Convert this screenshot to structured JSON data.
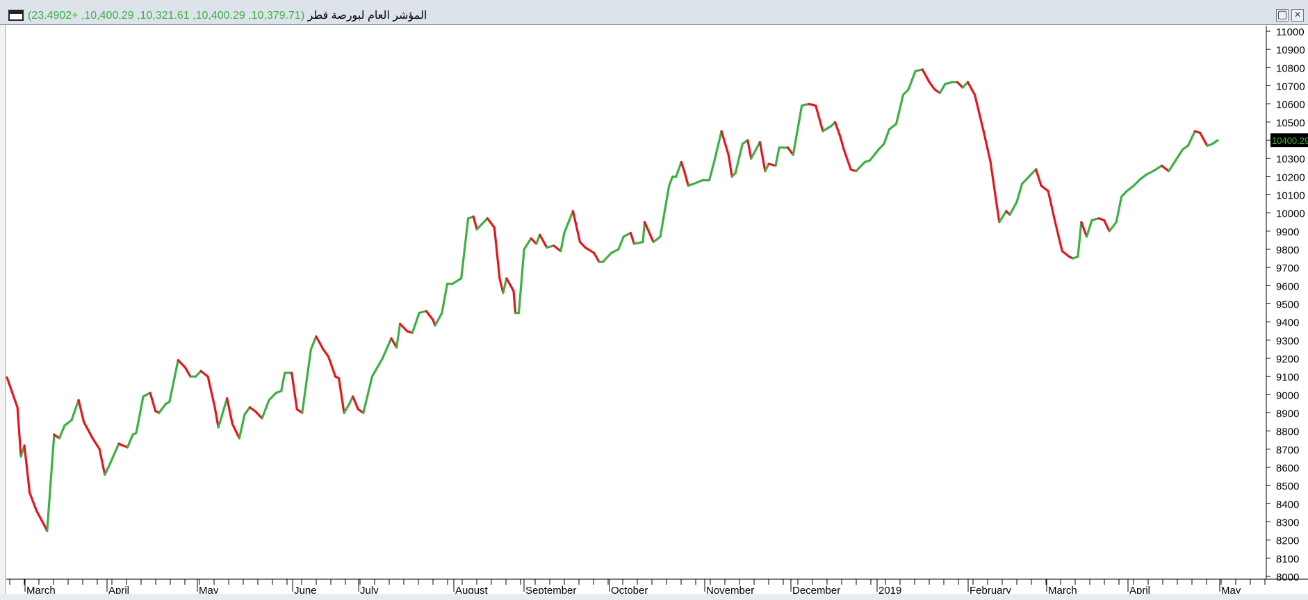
{
  "window": {
    "title": "المؤشر العام لبورصة قطر",
    "values_text": "(10,379.71, 10,400.29, 10,321.61, 10,400.29, +23.4902)",
    "maximize_icon": "maximize-icon",
    "close_icon": "close-icon"
  },
  "chart_data": {
    "type": "line",
    "title": "المؤشر العام لبورصة قطر",
    "ohlc_readout": {
      "open": 10379.71,
      "high": 10400.29,
      "low": 10321.61,
      "close": 10400.29,
      "change": 23.4902
    },
    "last_value_label": "10400.29",
    "ylim": [
      7950,
      11050
    ],
    "yticks": [
      8000,
      8100,
      8200,
      8300,
      8400,
      8500,
      8600,
      8700,
      8800,
      8900,
      9000,
      9100,
      9200,
      9300,
      9400,
      9500,
      9600,
      9700,
      9800,
      9900,
      10000,
      10100,
      10200,
      10300,
      10400,
      10500,
      10600,
      10700,
      10800,
      10900,
      11000
    ],
    "x_labels": [
      "March",
      "April",
      "May",
      "June",
      "July",
      "August",
      "September",
      "October",
      "November",
      "December",
      "2019",
      "February",
      "March",
      "April",
      "May"
    ],
    "x_range": [
      "2018-02-19",
      "2019-05-10"
    ],
    "up_color": "#3cb043",
    "down_color": "#e8141c",
    "grid": false,
    "series": [
      {
        "values": [
          [
            "2018-02-20",
            9095
          ],
          [
            "2018-02-26",
            8930
          ],
          [
            "2018-02-28",
            8660
          ],
          [
            "2018-03-02",
            8720
          ],
          [
            "2018-03-05",
            8460
          ],
          [
            "2018-03-09",
            8360
          ],
          [
            "2018-03-14",
            8270
          ],
          [
            "2018-03-15",
            8250
          ],
          [
            "2018-03-19",
            8780
          ],
          [
            "2018-03-22",
            8760
          ],
          [
            "2018-03-25",
            8830
          ],
          [
            "2018-03-29",
            8860
          ],
          [
            "2018-04-02",
            8970
          ],
          [
            "2018-04-05",
            8850
          ],
          [
            "2018-04-10",
            8760
          ],
          [
            "2018-04-14",
            8700
          ],
          [
            "2018-04-17",
            8560
          ],
          [
            "2018-04-20",
            8620
          ],
          [
            "2018-04-25",
            8730
          ],
          [
            "2018-04-30",
            8710
          ],
          [
            "2018-05-03",
            8780
          ],
          [
            "2018-05-05",
            8790
          ],
          [
            "2018-05-09",
            8990
          ],
          [
            "2018-05-13",
            9010
          ],
          [
            "2018-05-16",
            8910
          ],
          [
            "2018-05-18",
            8900
          ],
          [
            "2018-05-22",
            8950
          ],
          [
            "2018-05-24",
            8960
          ],
          [
            "2018-05-29",
            9190
          ],
          [
            "2018-06-02",
            9150
          ],
          [
            "2018-06-05",
            9100
          ],
          [
            "2018-06-08",
            9100
          ],
          [
            "2018-06-11",
            9130
          ],
          [
            "2018-06-15",
            9100
          ],
          [
            "2018-06-19",
            8930
          ],
          [
            "2018-06-21",
            8820
          ],
          [
            "2018-06-26",
            8980
          ],
          [
            "2018-06-29",
            8840
          ],
          [
            "2018-07-03",
            8760
          ],
          [
            "2018-07-06",
            8890
          ],
          [
            "2018-07-09",
            8930
          ],
          [
            "2018-07-12",
            8910
          ],
          [
            "2018-07-16",
            8870
          ],
          [
            "2018-07-20",
            8970
          ],
          [
            "2018-07-24",
            9010
          ],
          [
            "2018-07-27",
            9020
          ],
          [
            "2018-07-29",
            9120
          ],
          [
            "2018-08-02",
            9120
          ],
          [
            "2018-08-05",
            8920
          ],
          [
            "2018-08-08",
            8900
          ],
          [
            "2018-08-13",
            9250
          ],
          [
            "2018-08-16",
            9320
          ],
          [
            "2018-08-20",
            9250
          ],
          [
            "2018-08-23",
            9210
          ],
          [
            "2018-08-27",
            9100
          ],
          [
            "2018-08-29",
            9090
          ],
          [
            "2018-09-01",
            8900
          ],
          [
            "2018-09-04",
            8950
          ],
          [
            "2018-09-06",
            8990
          ],
          [
            "2018-09-09",
            8920
          ],
          [
            "2018-09-12",
            8900
          ],
          [
            "2018-09-17",
            9100
          ],
          [
            "2018-09-23",
            9200
          ],
          [
            "2018-09-28",
            9310
          ],
          [
            "2018-10-01",
            9260
          ],
          [
            "2018-10-03",
            9390
          ],
          [
            "2018-10-07",
            9350
          ],
          [
            "2018-10-10",
            9340
          ],
          [
            "2018-10-14",
            9450
          ],
          [
            "2018-10-18",
            9460
          ],
          [
            "2018-10-22",
            9410
          ],
          [
            "2018-10-23",
            9380
          ],
          [
            "2018-10-27",
            9450
          ],
          [
            "2018-10-30",
            9610
          ],
          [
            "2018-11-02",
            9610
          ],
          [
            "2018-11-07",
            9640
          ],
          [
            "2018-11-11",
            9970
          ],
          [
            "2018-11-14",
            9980
          ],
          [
            "2018-11-16",
            9910
          ],
          [
            "2018-11-19",
            9940
          ],
          [
            "2018-11-22",
            9970
          ],
          [
            "2018-11-26",
            9920
          ],
          [
            "2018-11-29",
            9640
          ],
          [
            "2018-12-01",
            9560
          ],
          [
            "2018-12-03",
            9640
          ],
          [
            "2018-12-07",
            9570
          ],
          [
            "2018-12-08",
            9450
          ],
          [
            "2018-12-10",
            9450
          ],
          [
            "2018-12-13",
            9800
          ],
          [
            "2018-12-17",
            9860
          ],
          [
            "2018-12-20",
            9830
          ],
          [
            "2018-12-22",
            9880
          ],
          [
            "2018-12-26",
            9810
          ],
          [
            "2018-12-30",
            9820
          ],
          [
            "2019-01-03",
            9790
          ],
          [
            "2019-01-05",
            9890
          ],
          [
            "2019-01-10",
            10010
          ],
          [
            "2019-01-14",
            9840
          ],
          [
            "2019-01-17",
            9810
          ],
          [
            "2019-01-22",
            9780
          ],
          [
            "2019-01-25",
            9730
          ],
          [
            "2019-01-27",
            9730
          ],
          [
            "2019-02-01",
            9780
          ],
          [
            "2019-02-05",
            9800
          ],
          [
            "2019-02-08",
            9870
          ],
          [
            "2019-02-12",
            9890
          ],
          [
            "2019-02-14",
            9830
          ],
          [
            "2019-02-19",
            9840
          ],
          [
            "2019-02-20",
            9950
          ],
          [
            "2019-02-25",
            9840
          ],
          [
            "2019-03-01",
            9870
          ],
          [
            "2019-03-06",
            10150
          ],
          [
            "2019-03-08",
            10200
          ],
          [
            "2019-03-10",
            10200
          ],
          [
            "2019-03-13",
            10280
          ],
          [
            "2019-03-15",
            10220
          ],
          [
            "2019-03-17",
            10150
          ],
          [
            "2019-03-20",
            10160
          ],
          [
            "2019-03-25",
            10180
          ],
          [
            "2019-03-29",
            10180
          ],
          [
            "2019-04-01",
            10290
          ],
          [
            "2019-04-05",
            10450
          ],
          [
            "2019-04-09",
            10320
          ],
          [
            "2019-04-11",
            10200
          ],
          [
            "2019-04-13",
            10220
          ],
          [
            "2019-04-17",
            10380
          ],
          [
            "2019-04-20",
            10400
          ],
          [
            "2019-04-22",
            10300
          ],
          [
            "2019-04-27",
            10390
          ],
          [
            "2019-04-30",
            10230
          ],
          [
            "2019-05-02",
            10270
          ],
          [
            "2019-05-06",
            10260
          ],
          [
            "2019-05-08",
            10360
          ],
          [
            "2019-05-13",
            10360
          ],
          [
            "2019-05-16",
            10320
          ],
          [
            "2019-05-21",
            10590
          ],
          [
            "2019-05-25",
            10600
          ],
          [
            "2019-05-29",
            10590
          ],
          [
            "2019-06-02",
            10450
          ],
          [
            "2019-06-07",
            10480
          ],
          [
            "2019-06-09",
            10500
          ],
          [
            "2019-06-12",
            10420
          ],
          [
            "2019-06-14",
            10350
          ],
          [
            "2019-06-18",
            10240
          ],
          [
            "2019-06-21",
            10230
          ],
          [
            "2019-06-26",
            10280
          ],
          [
            "2019-06-29",
            10290
          ],
          [
            "2019-07-04",
            10350
          ],
          [
            "2019-07-07",
            10380
          ],
          [
            "2019-07-10",
            10460
          ],
          [
            "2019-07-14",
            10490
          ],
          [
            "2019-07-18",
            10650
          ],
          [
            "2019-07-21",
            10680
          ],
          [
            "2019-07-25",
            10780
          ],
          [
            "2019-07-29",
            10790
          ],
          [
            "2019-08-02",
            10720
          ],
          [
            "2019-08-05",
            10680
          ],
          [
            "2019-08-08",
            10660
          ],
          [
            "2019-08-11",
            10710
          ],
          [
            "2019-08-15",
            10720
          ],
          [
            "2019-08-18",
            10720
          ],
          [
            "2019-08-21",
            10690
          ],
          [
            "2019-08-24",
            10720
          ],
          [
            "2019-08-28",
            10650
          ],
          [
            "2019-09-02",
            10450
          ],
          [
            "2019-09-06",
            10280
          ],
          [
            "2019-09-11",
            9950
          ],
          [
            "2019-09-15",
            10010
          ],
          [
            "2019-09-17",
            9990
          ],
          [
            "2019-09-21",
            10060
          ],
          [
            "2019-09-24",
            10160
          ],
          [
            "2019-09-28",
            10200
          ],
          [
            "2019-10-02",
            10240
          ],
          [
            "2019-10-05",
            10150
          ],
          [
            "2019-10-09",
            10120
          ],
          [
            "2019-10-13",
            9950
          ],
          [
            "2019-10-17",
            9790
          ],
          [
            "2019-10-21",
            9760
          ],
          [
            "2019-10-23",
            9750
          ],
          [
            "2019-10-26",
            9760
          ],
          [
            "2019-10-28",
            9950
          ],
          [
            "2019-10-31",
            9870
          ],
          [
            "2019-11-03",
            9960
          ],
          [
            "2019-11-07",
            9970
          ],
          [
            "2019-11-10",
            9960
          ],
          [
            "2019-11-13",
            9900
          ],
          [
            "2019-11-17",
            9950
          ],
          [
            "2019-11-20",
            10090
          ],
          [
            "2019-11-23",
            10120
          ],
          [
            "2019-11-27",
            10150
          ],
          [
            "2019-11-30",
            10180
          ],
          [
            "2019-12-04",
            10210
          ],
          [
            "2019-12-08",
            10230
          ],
          [
            "2019-12-13",
            10260
          ],
          [
            "2019-12-17",
            10230
          ],
          [
            "2019-12-21",
            10290
          ],
          [
            "2019-12-25",
            10350
          ],
          [
            "2019-12-28",
            10370
          ],
          [
            "2020-01-01",
            10450
          ],
          [
            "2020-01-04",
            10440
          ],
          [
            "2020-01-08",
            10370
          ],
          [
            "2020-01-11",
            10380
          ],
          [
            "2020-01-14",
            10400
          ]
        ]
      }
    ]
  }
}
